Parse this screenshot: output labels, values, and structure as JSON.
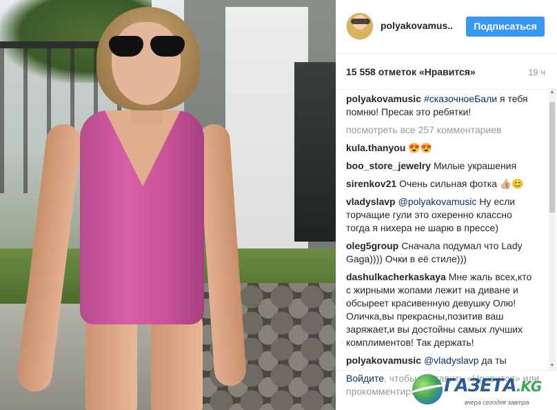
{
  "post": {
    "username": "polyakovamus..",
    "follow_label": "Подписаться",
    "likes": "15 558 отметок «Нравится»",
    "time": "19 ч"
  },
  "comments": [
    {
      "user": "polyakovamusic",
      "mention": "#сказочноеБали",
      "text": "я тебя помню! Пресак это ребятки!"
    },
    {
      "view_all": "посмотреть все 257 комментариев"
    },
    {
      "user": "kula.thanyou",
      "text": "😍😍"
    },
    {
      "user": "boo_store_jewelry",
      "text": "Милые украшения"
    },
    {
      "user": "sirenkov21",
      "text": "Очень сильная фотка 👍🏼😊"
    },
    {
      "user": "vladyslavp",
      "mention": "@polyakovamusic",
      "text": "Ну если торчащие гули это охеренно классно тогда я нихера не шарю в прессе)"
    },
    {
      "user": "oleg5group",
      "text": "Сначала подумал что Lady Gaga)))) Очки в её стиле)))"
    },
    {
      "user": "dashulkacherkaskaya",
      "text": "Мне жаль всех,кто с жирными жопами лежит на диване и обсыреет красивенную девушку Олю!Оличка,вы прекрасны,позитив ваш заряжает,и вы достойны самых лучших комплиментов! Так держать!"
    },
    {
      "user": "polyakovamusic",
      "mention": "@vladyslavp",
      "text": "да ты"
    }
  ],
  "footer": {
    "login": "Войдите",
    "rest": ", чтобы поставить «Нравится» или прокомментировать."
  },
  "watermark": {
    "logo": "ГАЗЕТА",
    "tld": ".KG",
    "tagline": "вчера сегодня завтра"
  },
  "colors": {
    "follow_button": "#3897f0",
    "link": "#003569",
    "muted": "#999999",
    "swimsuit": "#d760a8"
  },
  "icons": [
    "scroll-up-arrow-icon",
    "scroll-down-arrow-icon",
    "globe-logo-icon"
  ]
}
